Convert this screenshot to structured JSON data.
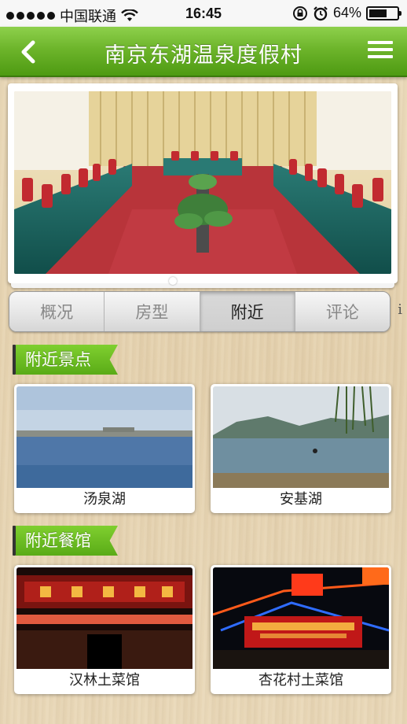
{
  "status_bar": {
    "carrier": "中国联通",
    "time": "16:45",
    "battery_percent_label": "64%",
    "battery_level": 0.64,
    "icons": [
      "signal-dots-icon",
      "wifi-icon",
      "rotation-lock-icon",
      "alarm-icon",
      "battery-icon"
    ]
  },
  "nav": {
    "title": "南京东湖温泉度假村",
    "back_icon": "chevron-left-icon",
    "menu_icon": "hamburger-menu-icon"
  },
  "tabs": [
    {
      "label": "概况",
      "active": false
    },
    {
      "label": "房型",
      "active": false
    },
    {
      "label": "附近",
      "active": true
    },
    {
      "label": "评论",
      "active": false
    }
  ],
  "tab_more_glyph": "i",
  "sections": {
    "scenic": {
      "title": "附近景点",
      "items": [
        {
          "name": "汤泉湖"
        },
        {
          "name": "安基湖"
        }
      ]
    },
    "restaurants": {
      "title": "附近餐馆",
      "items": [
        {
          "name": "汉林土菜馆"
        },
        {
          "name": "杏花村土菜馆"
        }
      ]
    }
  },
  "colors": {
    "nav_green": "#6db52b",
    "ribbon_green": "#6cbf23",
    "wood": "#e9d8b8"
  }
}
